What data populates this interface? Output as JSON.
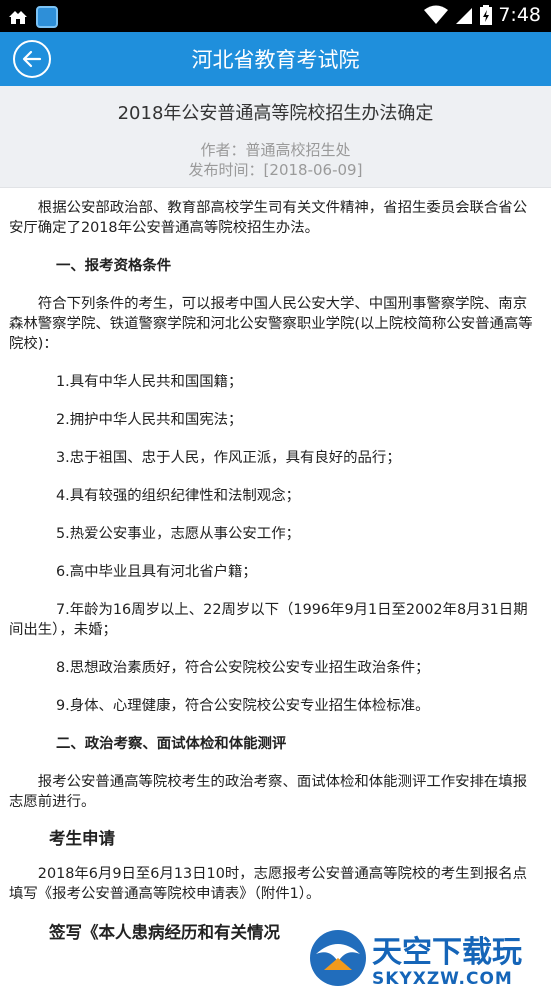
{
  "status_bar": {
    "time": "7:48"
  },
  "app_bar": {
    "title": "河北省教育考试院"
  },
  "article": {
    "title": "2018年公安普通高等院校招生办法确定",
    "author": "作者：普通高校招生处",
    "published": "发布时间：[2018-06-09]",
    "paragraphs": {
      "intro": "根据公安部政治部、教育部高校学生司有关文件精神，省招生委员会联合省公安厅确定了2018年公安普通高等院校招生办法。",
      "section1_heading": "一、报考资格条件",
      "section1_intro": "符合下列条件的考生，可以报考中国人民公安大学、中国刑事警察学院、南京森林警察学院、铁道警察学院和河北公安警察职业学院(以上院校简称公安普通高等院校)：",
      "item1": "1.具有中华人民共和国国籍；",
      "item2": "2.拥护中华人民共和国宪法；",
      "item3": "3.忠于祖国、忠于人民，作风正派，具有良好的品行；",
      "item4": "4.具有较强的组织纪律性和法制观念；",
      "item5": "5.热爱公安事业，志愿从事公安工作；",
      "item6": "6.高中毕业且具有河北省户籍；",
      "item7": "7.年龄为16周岁以上、22周岁以下（1996年9月1日至2002年8月31日期间出生），未婚；",
      "item8": "8.思想政治素质好，符合公安院校公安专业招生政治条件；",
      "item9": "9.身体、心理健康，符合公安院校公安专业招生体检标准。",
      "section2_heading": "二、政治考察、面试体检和体能测评",
      "section2_intro": "报考公安普通高等院校考生的政治考察、面试体检和体能测评工作安排在填报志愿前进行。",
      "subheading1": "考生申请",
      "apply_text": "2018年6月9日至6月13日10时，志愿报考公安普通高等院校的考生到报名点填写《报考公安普通高等院校申请表》（附件1）。",
      "subheading2": "签写《本人患病经历和有关情况"
    }
  },
  "watermark": {
    "brand": "天空下载玩",
    "domain": "SKYXZW.COM"
  }
}
